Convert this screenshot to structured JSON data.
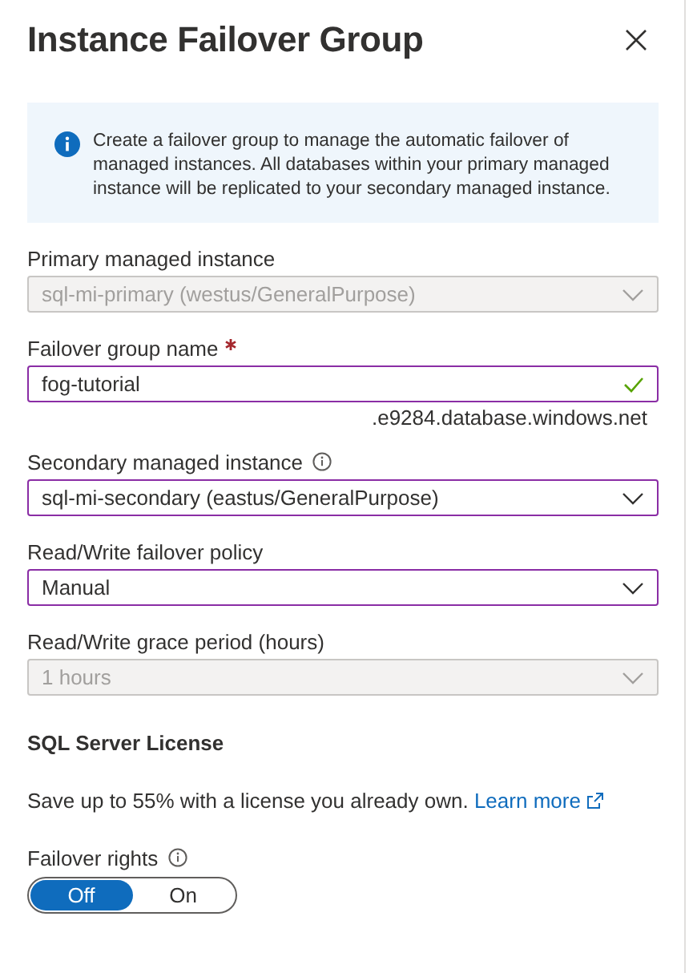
{
  "window": {
    "title": "Instance Failover Group"
  },
  "info": {
    "text": "Create a failover group to manage the automatic failover of managed instances. All databases within your primary managed instance will be replicated to your secondary managed instance."
  },
  "fields": [
    {
      "kind": "dropdown",
      "label": "Primary managed instance",
      "value": "sql-mi-primary (westus/GeneralPurpose)",
      "disabled": true,
      "focused": false
    },
    {
      "kind": "text",
      "label": "Failover group name",
      "value": "fog-tutorial",
      "disabled": false,
      "focused": true,
      "required": true,
      "valid": true,
      "suffix": ".e9284.database.windows.net"
    },
    {
      "kind": "dropdown",
      "label": "Secondary managed instance",
      "value": "sql-mi-secondary (eastus/GeneralPurpose)",
      "disabled": false,
      "focused": true,
      "info_icon": true
    },
    {
      "kind": "dropdown",
      "label": "Read/Write failover policy",
      "value": "Manual",
      "disabled": false,
      "focused": true
    },
    {
      "kind": "dropdown",
      "label": "Read/Write grace period (hours)",
      "value": "1 hours",
      "disabled": true,
      "focused": false
    }
  ],
  "license": {
    "heading": "SQL Server License",
    "text": "Save up to 55% with a license you already own.",
    "link": "Learn more"
  },
  "failover_rights": {
    "label": "Failover rights",
    "info_icon": true,
    "options": [
      {
        "label": "Off",
        "selected": true
      },
      {
        "label": "On",
        "selected": false
      }
    ]
  }
}
